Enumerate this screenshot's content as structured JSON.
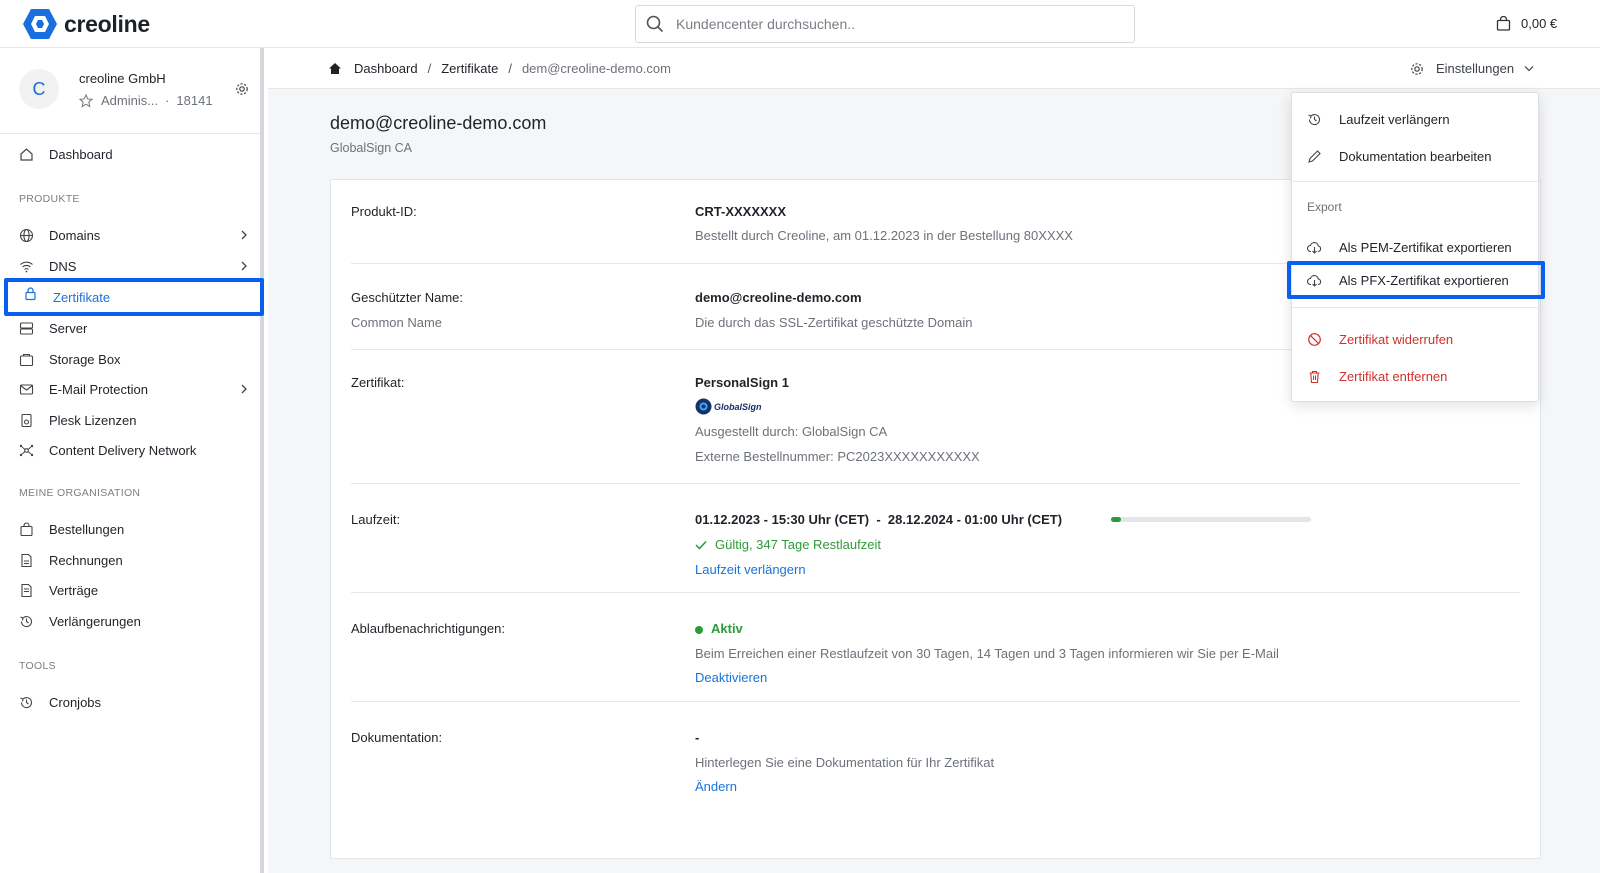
{
  "brand": {
    "name": "creoline",
    "color": "#1a6fe0"
  },
  "search": {
    "placeholder": "Kundencenter durchsuchen.."
  },
  "cart": {
    "amount": "0,00 €",
    "icon": "shopping-bag-icon"
  },
  "org": {
    "avatar_letter": "C",
    "name": "creoline GmbH",
    "role": "Adminis...",
    "separator": "·",
    "number": "18141"
  },
  "sidebar": {
    "dashboard": "Dashboard",
    "section_products": "PRODUKTE",
    "products": [
      {
        "label": "Domains",
        "icon": "globe-icon",
        "has_arrow": true
      },
      {
        "label": "DNS",
        "icon": "wifi-icon",
        "has_arrow": true
      },
      {
        "label": "Zertifikate",
        "icon": "lock-icon",
        "active": true
      },
      {
        "label": "Server",
        "icon": "server-icon"
      },
      {
        "label": "Storage Box",
        "icon": "box-icon"
      },
      {
        "label": "E-Mail Protection",
        "icon": "mail-icon",
        "has_arrow": true
      },
      {
        "label": "Plesk Lizenzen",
        "icon": "license-icon"
      },
      {
        "label": "Content Delivery Network",
        "icon": "network-icon"
      }
    ],
    "section_org": "MEINE ORGANISATION",
    "org_items": [
      {
        "label": "Bestellungen",
        "icon": "bag-icon"
      },
      {
        "label": "Rechnungen",
        "icon": "invoice-icon"
      },
      {
        "label": "Verträge",
        "icon": "contract-icon"
      },
      {
        "label": "Verlängerungen",
        "icon": "history-icon"
      }
    ],
    "section_tools": "TOOLS",
    "tools": [
      {
        "label": "Cronjobs",
        "icon": "history-icon"
      }
    ]
  },
  "breadcrumb": {
    "home": "Dashboard",
    "sep": "/",
    "section": "Zertifikate",
    "current": "dem@creoline-demo.com"
  },
  "settings_label": "Einstellungen",
  "page": {
    "title": "demo@creoline-demo.com",
    "subtitle": "GlobalSign CA"
  },
  "details": {
    "product_id_label": "Produkt-ID:",
    "product_id": "CRT-XXXXXXX",
    "ordered_by": "Bestellt durch Creoline, am 01.12.2023 in der Bestellung 80XXXX",
    "protected_name_label": "Geschützter Name:",
    "protected_name_sublabel": "Common Name",
    "protected_name": "demo@creoline-demo.com",
    "protected_name_desc": "Die durch das SSL-Zertifikat geschützte Domain",
    "certificate_label": "Zertifikat:",
    "certificate_name": "PersonalSign 1",
    "certificate_logo_text": "GlobalSign",
    "issued_by": "Ausgestellt durch: GlobalSign CA",
    "external_order": "Externe Bestellnummer: PC2023XXXXXXXXXXX",
    "runtime_label": "Laufzeit:",
    "runtime_range": "01.12.2023 - 15:30 Uhr (CET)  -  28.12.2024 - 01:00 Uhr (CET)",
    "runtime_progress": 0.05,
    "runtime_status": "Gültig, 347 Tage Restlaufzeit",
    "runtime_extend_link": "Laufzeit verlängern",
    "expiry_label": "Ablaufbenachrichtigungen:",
    "expiry_status": "Aktiv",
    "expiry_desc": "Beim Erreichen einer Restlaufzeit von 30 Tagen, 14 Tagen und 3 Tagen informieren wir Sie per E-Mail",
    "expiry_link": "Deaktivieren",
    "doc_label": "Dokumentation:",
    "doc_value": "-",
    "doc_desc": "Hinterlegen Sie eine Dokumentation für Ihr Zertifikat",
    "doc_link": "Ändern"
  },
  "menu": {
    "extend": "Laufzeit verlängern",
    "edit_doc": "Dokumentation bearbeiten",
    "export_header": "Export",
    "export_pem": "Als PEM-Zertifikat exportieren",
    "export_pfx": "Als PFX-Zertifikat exportieren",
    "revoke": "Zertifikat widerrufen",
    "remove": "Zertifikat entfernen"
  },
  "colors": {
    "accent": "#1a73d9",
    "highlight": "#0a60ee",
    "success": "#2f9a3a",
    "danger": "#d0312d"
  }
}
